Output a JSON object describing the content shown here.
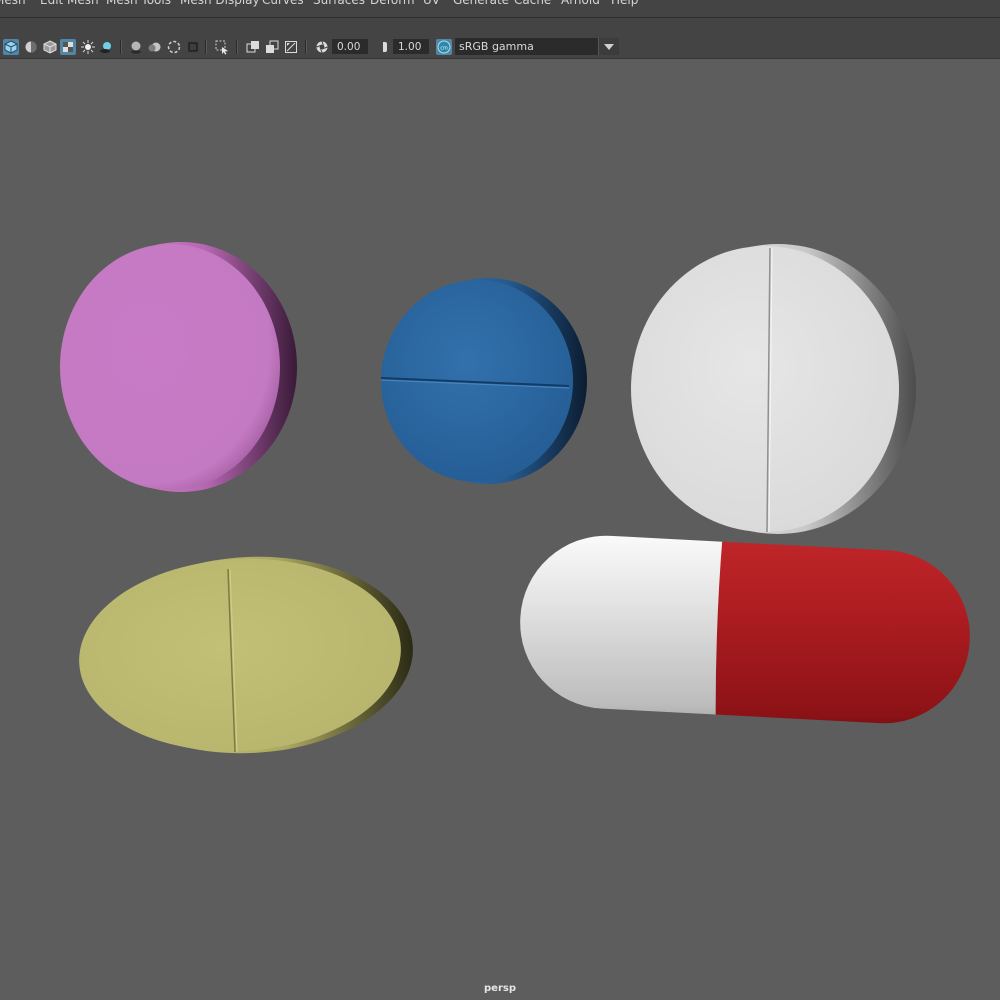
{
  "menubar": {
    "items": [
      "Mesh",
      "Edit Mesh",
      "Mesh Tools",
      "Mesh Display",
      "Curves",
      "Surfaces",
      "Deform",
      "UV",
      "Generate",
      "Cache",
      "Arnold",
      "Help"
    ]
  },
  "toolbar": {
    "icons": [
      "wireframe-shaded-icon",
      "smooth-shade-icon",
      "wireframe-on-shaded-icon",
      "textured-icon",
      "use-all-lights-icon",
      "shadows-icon",
      "screen-space-ao-icon",
      "motion-blur-icon",
      "anti-alias-icon",
      "depth-of-field-icon",
      "isolate-select-icon",
      "xray-icon",
      "xray-active-icon",
      "xray-joints-icon",
      "exposure-icon",
      "gamma-icon",
      "color-management-icon"
    ],
    "exposure_value": "0.00",
    "gamma_value": "1.00",
    "color_space": "sRGB gamma"
  },
  "viewport": {
    "camera_label": "persp",
    "background_color": "#5d5d5d"
  },
  "scene": {
    "objects": [
      {
        "name": "pink-round-tablet",
        "color": "#c97ec6"
      },
      {
        "name": "blue-scored-tablet",
        "color": "#2e6aa6"
      },
      {
        "name": "white-scored-tablet",
        "color": "#e4e4e4"
      },
      {
        "name": "yellow-oval-tablet",
        "color": "#bfbd72"
      },
      {
        "name": "capsule",
        "colors": [
          "#e2e2e2",
          "#b01e22"
        ]
      }
    ]
  }
}
